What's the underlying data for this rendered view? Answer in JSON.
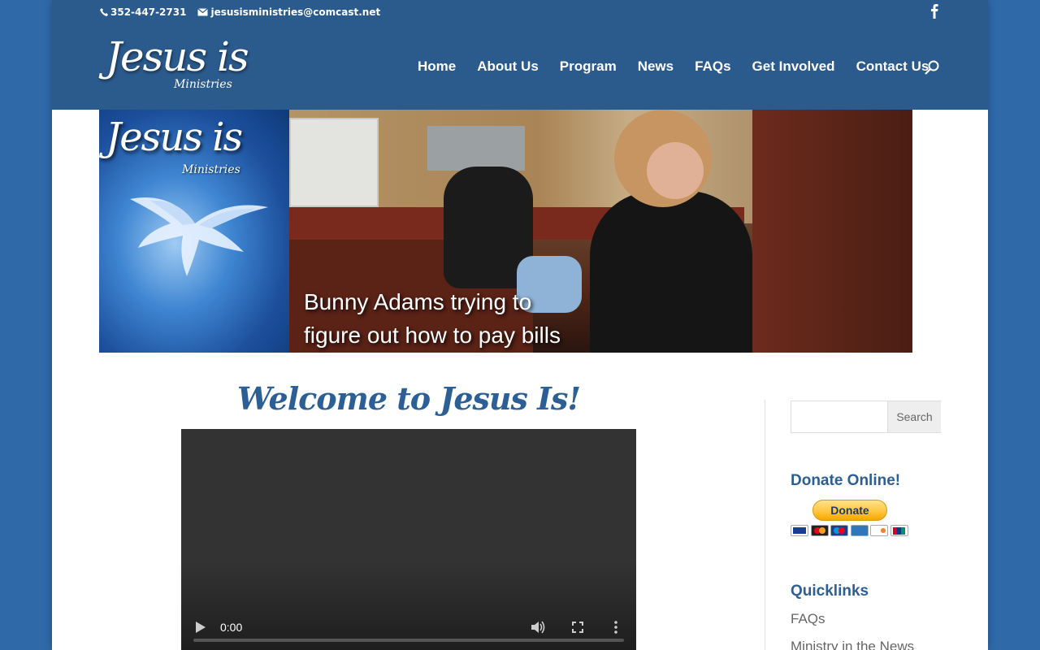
{
  "topbar": {
    "phone": "352-447-2731",
    "email": "jesusisministries@comcast.net"
  },
  "header": {
    "logo_main": "Jesus is",
    "logo_sub": "Ministries",
    "nav": [
      "Home",
      "About Us",
      "Program",
      "News",
      "FAQs",
      "Get Involved",
      "Contact Us"
    ]
  },
  "banner": {
    "logo_main": "Jesus is",
    "logo_sub": "Ministries",
    "caption_line1": "Bunny Adams trying to",
    "caption_line2": "figure out how to pay bills"
  },
  "main": {
    "welcome": "Welcome to Jesus Is!",
    "video_time": "0:00"
  },
  "sidebar": {
    "search_button": "Search",
    "donate_title": "Donate Online!",
    "donate_button": "Donate",
    "cards": [
      "VISA",
      "MC",
      "Maestro",
      "AMEX",
      "DISCOVER",
      "UnionPay"
    ],
    "quicklinks_title": "Quicklinks",
    "quicklinks": [
      "FAQs",
      "Ministry in the News"
    ]
  },
  "colors": {
    "page_bg": "#2f69a8",
    "header_bg": "#2b5a8d",
    "heading_blue": "#2b5f95"
  }
}
